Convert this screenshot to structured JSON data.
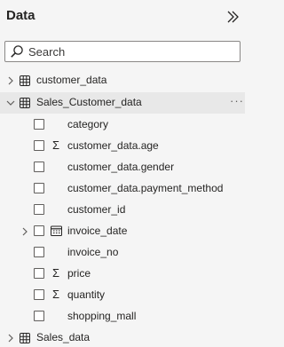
{
  "pane": {
    "title": "Data",
    "collapse_icon": "double-chevron-right-icon"
  },
  "search": {
    "placeholder": "Search",
    "value": ""
  },
  "tables": [
    {
      "name": "customer_data",
      "expanded": false
    },
    {
      "name": "Sales_Customer_data",
      "expanded": true,
      "more_label": "···",
      "fields": [
        {
          "name": "category",
          "type": "text",
          "checked": false
        },
        {
          "name": "customer_data.age",
          "type": "sum",
          "checked": false
        },
        {
          "name": "customer_data.gender",
          "type": "text",
          "checked": false
        },
        {
          "name": "customer_data.payment_method",
          "type": "text",
          "checked": false
        },
        {
          "name": "customer_id",
          "type": "text",
          "checked": false
        },
        {
          "name": "invoice_date",
          "type": "date-hierarchy",
          "checked": false,
          "expandable": true
        },
        {
          "name": "invoice_no",
          "type": "text",
          "checked": false
        },
        {
          "name": "price",
          "type": "sum",
          "checked": false
        },
        {
          "name": "quantity",
          "type": "sum",
          "checked": false
        },
        {
          "name": "shopping_mall",
          "type": "text",
          "checked": false
        }
      ]
    },
    {
      "name": "Sales_data",
      "expanded": false
    }
  ],
  "glyphs": {
    "sigma": "Σ"
  },
  "colors": {
    "background": "#f5f5f5",
    "selected_row": "#e8e8e8",
    "text": "#252423"
  }
}
